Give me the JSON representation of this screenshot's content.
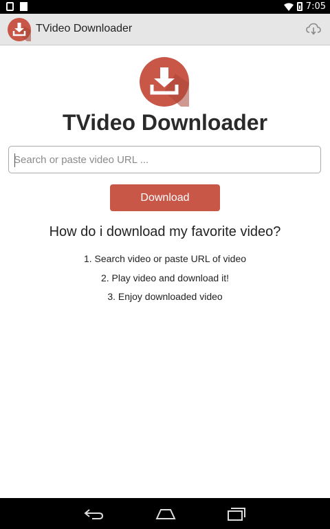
{
  "status_bar": {
    "time": "7:05",
    "icons": [
      "phone-notification-icon",
      "notification-square-icon",
      "wifi-icon",
      "battery-icon"
    ]
  },
  "action_bar": {
    "title": "TVideo Downloader",
    "icons": [
      "app-logo-icon",
      "cloud-download-icon"
    ]
  },
  "hero": {
    "title": "TVideo Downloader",
    "logo_icon": "download-tray-icon"
  },
  "search": {
    "placeholder": "Search or paste video URL ...",
    "value": ""
  },
  "download_button": {
    "label": "Download"
  },
  "help": {
    "title": "How do i download my favorite video?",
    "steps": [
      "1. Search video or paste URL of video",
      "2. Play video and download it!",
      "3. Enjoy downloaded video"
    ]
  },
  "nav_bar": {
    "icons": [
      "back-icon",
      "home-icon",
      "recent-apps-icon"
    ]
  },
  "colors": {
    "brand_red": "#c85748",
    "action_bar_bg": "#e6e6e6",
    "system_bar_bg": "#000000"
  }
}
